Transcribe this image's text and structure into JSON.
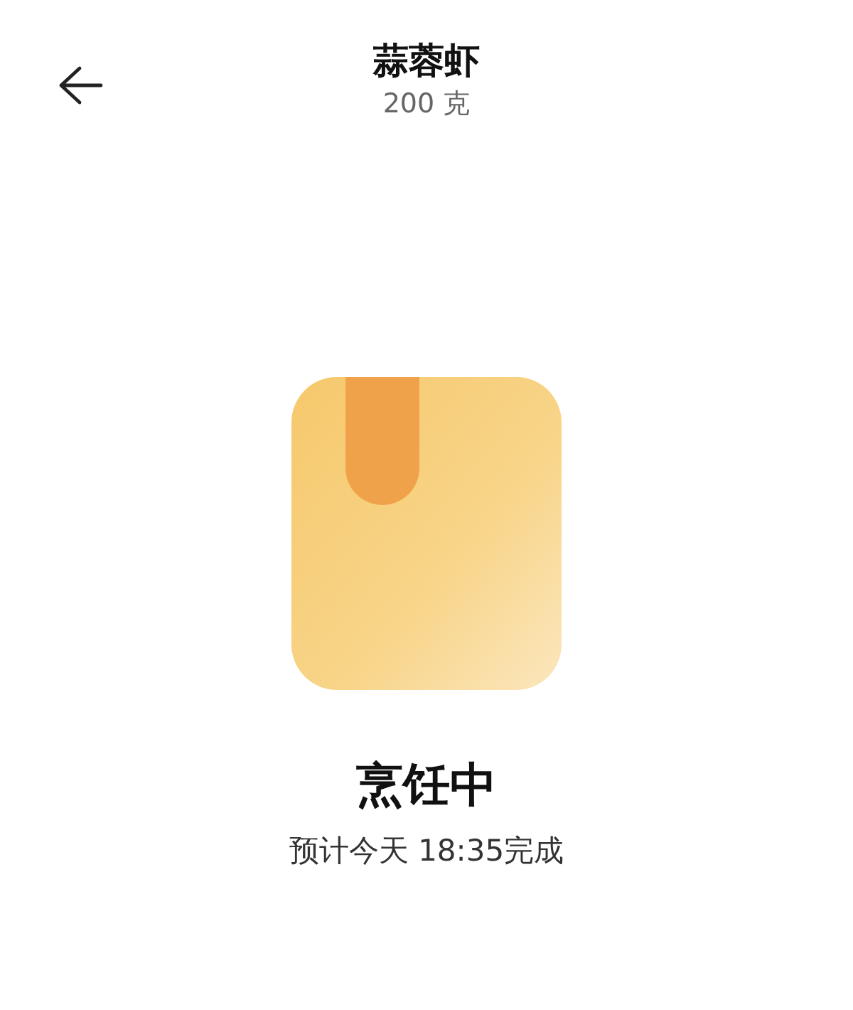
{
  "header": {
    "title": "蒜蓉虾",
    "subtitle": "200 克"
  },
  "status": {
    "title": "烹饪中",
    "eta": "预计今天 18:35完成"
  }
}
